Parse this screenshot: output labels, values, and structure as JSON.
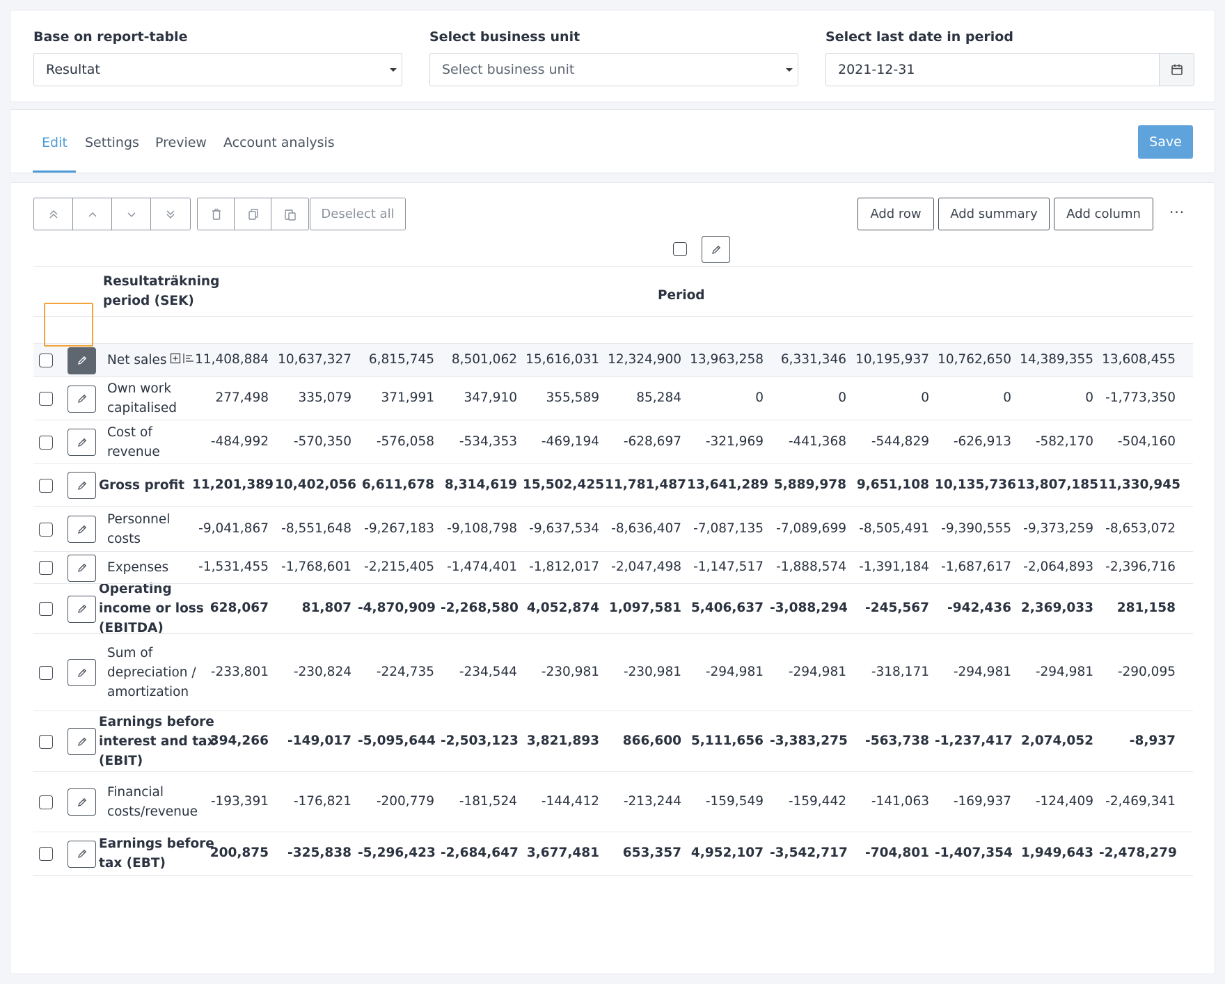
{
  "filters": {
    "report_table": {
      "label": "Base on report-table",
      "value": "Resultat"
    },
    "business_unit": {
      "label": "Select business unit",
      "placeholder": "Select business unit"
    },
    "last_date": {
      "label": "Select last date in period",
      "value": "2021-12-31"
    }
  },
  "tabs": [
    {
      "label": "Edit",
      "active": true
    },
    {
      "label": "Settings"
    },
    {
      "label": "Preview"
    },
    {
      "label": "Account analysis"
    }
  ],
  "save_label": "Save",
  "toolbar": {
    "deselect_all": "Deselect all",
    "add_row": "Add row",
    "add_summary": "Add summary",
    "add_column": "Add column",
    "more": "···"
  },
  "table": {
    "title": "Resultaträkning period (SEK)",
    "title_lines": [
      "Resultaträkning",
      "period (SEK)"
    ],
    "column_group": "Period",
    "rows": [
      {
        "label_lines": [
          "Net sales"
        ],
        "bold": false,
        "values": [
          "11,408,884",
          "10,637,327",
          "6,815,745",
          "8,501,062",
          "15,616,031",
          "12,324,900",
          "13,963,258",
          "6,331,346",
          "10,195,937",
          "10,762,650",
          "14,389,355",
          "13,608,455"
        ]
      },
      {
        "label_lines": [
          "Own work",
          "capitalised"
        ],
        "bold": false,
        "values": [
          "277,498",
          "335,079",
          "371,991",
          "347,910",
          "355,589",
          "85,284",
          "0",
          "0",
          "0",
          "0",
          "0",
          "-1,773,350"
        ]
      },
      {
        "label_lines": [
          "Cost of",
          "revenue"
        ],
        "bold": false,
        "values": [
          "-484,992",
          "-570,350",
          "-576,058",
          "-534,353",
          "-469,194",
          "-628,697",
          "-321,969",
          "-441,368",
          "-544,829",
          "-626,913",
          "-582,170",
          "-504,160"
        ]
      },
      {
        "label_lines": [
          "Gross profit"
        ],
        "bold": true,
        "values": [
          "11,201,389",
          "10,402,056",
          "6,611,678",
          "8,314,619",
          "15,502,425",
          "11,781,487",
          "13,641,289",
          "5,889,978",
          "9,651,108",
          "10,135,736",
          "13,807,185",
          "11,330,945"
        ]
      },
      {
        "label_lines": [
          "Personnel",
          "costs"
        ],
        "bold": false,
        "values": [
          "-9,041,867",
          "-8,551,648",
          "-9,267,183",
          "-9,108,798",
          "-9,637,534",
          "-8,636,407",
          "-7,087,135",
          "-7,089,699",
          "-8,505,491",
          "-9,390,555",
          "-9,373,259",
          "-8,653,072"
        ]
      },
      {
        "label_lines": [
          "Expenses"
        ],
        "bold": false,
        "values": [
          "-1,531,455",
          "-1,768,601",
          "-2,215,405",
          "-1,474,401",
          "-1,812,017",
          "-2,047,498",
          "-1,147,517",
          "-1,888,574",
          "-1,391,184",
          "-1,687,617",
          "-2,064,893",
          "-2,396,716"
        ]
      },
      {
        "label_lines": [
          "Operating",
          "income or loss",
          "(EBITDA)"
        ],
        "bold": true,
        "values": [
          "628,067",
          "81,807",
          "-4,870,909",
          "-2,268,580",
          "4,052,874",
          "1,097,581",
          "5,406,637",
          "-3,088,294",
          "-245,567",
          "-942,436",
          "2,369,033",
          "281,158"
        ]
      },
      {
        "label_lines": [
          "Sum of",
          "depreciation /",
          "amortization"
        ],
        "bold": false,
        "values": [
          "-233,801",
          "-230,824",
          "-224,735",
          "-234,544",
          "-230,981",
          "-230,981",
          "-294,981",
          "-294,981",
          "-318,171",
          "-294,981",
          "-294,981",
          "-290,095"
        ]
      },
      {
        "label_lines": [
          "Earnings before",
          "interest and tax",
          "(EBIT)"
        ],
        "bold": true,
        "values": [
          "394,266",
          "-149,017",
          "-5,095,644",
          "-2,503,123",
          "3,821,893",
          "866,600",
          "5,111,656",
          "-3,383,275",
          "-563,738",
          "-1,237,417",
          "2,074,052",
          "-8,937"
        ]
      },
      {
        "label_lines": [
          "Financial",
          "costs/revenue"
        ],
        "bold": false,
        "values": [
          "-193,391",
          "-176,821",
          "-200,779",
          "-181,524",
          "-144,412",
          "-213,244",
          "-159,549",
          "-159,442",
          "-141,063",
          "-169,937",
          "-124,409",
          "-2,469,341"
        ]
      },
      {
        "label_lines": [
          "Earnings before",
          "tax (EBT)"
        ],
        "bold": true,
        "values": [
          "200,875",
          "-325,838",
          "-5,296,423",
          "-2,684,647",
          "3,677,481",
          "653,357",
          "4,952,107",
          "-3,542,717",
          "-704,801",
          "-1,407,354",
          "1,949,643",
          "-2,478,279"
        ]
      }
    ]
  },
  "colors": {
    "accent": "#4d9ad6",
    "focus": "#f2a33a"
  }
}
